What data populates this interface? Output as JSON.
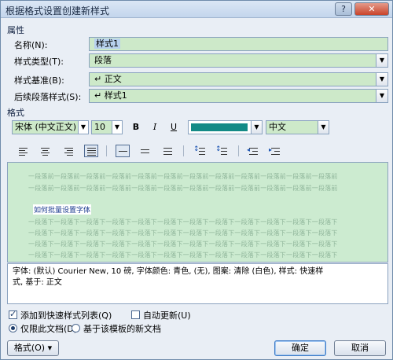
{
  "window": {
    "title": "根据格式设置创建新样式",
    "help_label": "?",
    "close_label": "✕"
  },
  "properties": {
    "group_label": "属性",
    "name_label": "名称(N):",
    "name_value": "样式1",
    "type_label": "样式类型(T):",
    "type_value": "段落",
    "based_on_label": "样式基准(B):",
    "based_on_value": "↵ 正文",
    "following_label": "后续段落样式(S):",
    "following_value": "↵ 样式1"
  },
  "format": {
    "group_label": "格式",
    "font": "宋体 (中文正文)",
    "size": "10",
    "bold_label": "B",
    "italic_label": "I",
    "underline_label": "U",
    "font_color": "#138a86",
    "language": "中文"
  },
  "preview": {
    "prev_lines": [
      "一段落前一段落前一段落前一段落前一段落前一段落前一段落前一段落前一段落前一段落前一段落前一段落前",
      "一段落前一段落前一段落前一段落前一段落前一段落前一段落前一段落前一段落前一段落前一段落前一段落前"
    ],
    "sample_text": "如何批量设置字体",
    "next_lines": [
      "一段落下一段落下一段落下一段落下一段落下一段落下一段落下一段落下一段落下一段落下一段落下一段落下",
      "一段落下一段落下一段落下一段落下一段落下一段落下一段落下一段落下一段落下一段落下一段落下一段落下",
      "一段落下一段落下一段落下一段落下一段落下一段落下一段落下一段落下一段落下一段落下一段落下一段落下",
      "一段落下一段落下一段落下一段落下一段落下一段落下一段落下一段落下一段落下一段落下一段落下一段落下"
    ]
  },
  "description": {
    "line1": "字体: (默认) Courier New, 10 磅, 字体颜色: 青色, (无), 图案: 清除 (白色), 样式: 快速样",
    "line2": "式, 基于: 正文"
  },
  "options": {
    "add_quick_style": "添加到快速样式列表(Q)",
    "auto_update": "自动更新(U)",
    "only_this_doc": "仅限此文档(D)",
    "new_docs_template": "基于该模板的新文档"
  },
  "buttons": {
    "format": "格式(O) ▾",
    "ok": "确定",
    "cancel": "取消"
  }
}
